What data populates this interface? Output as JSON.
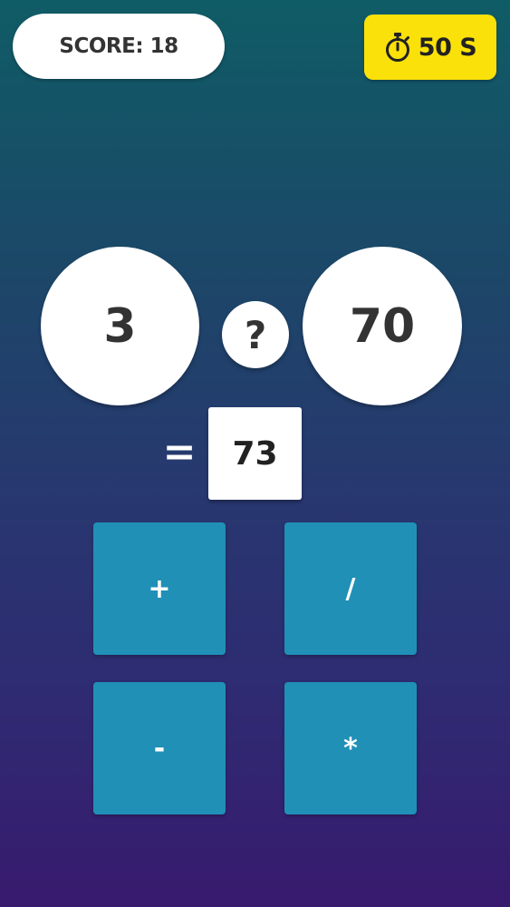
{
  "score": {
    "label": "SCORE:",
    "value": "18"
  },
  "timer": {
    "icon": "stopwatch-icon",
    "value": "50 S",
    "background_color": "#fbe10a"
  },
  "equation": {
    "left_operand": "3",
    "operator": "?",
    "right_operand": "70",
    "equals": "=",
    "result": "73"
  },
  "operators": {
    "plus": "+",
    "divide": "/",
    "minus": "-",
    "multiply": "*"
  },
  "colors": {
    "button": "#2090b6",
    "background_top": "#0f5c66",
    "background_bottom": "#381a6e"
  }
}
